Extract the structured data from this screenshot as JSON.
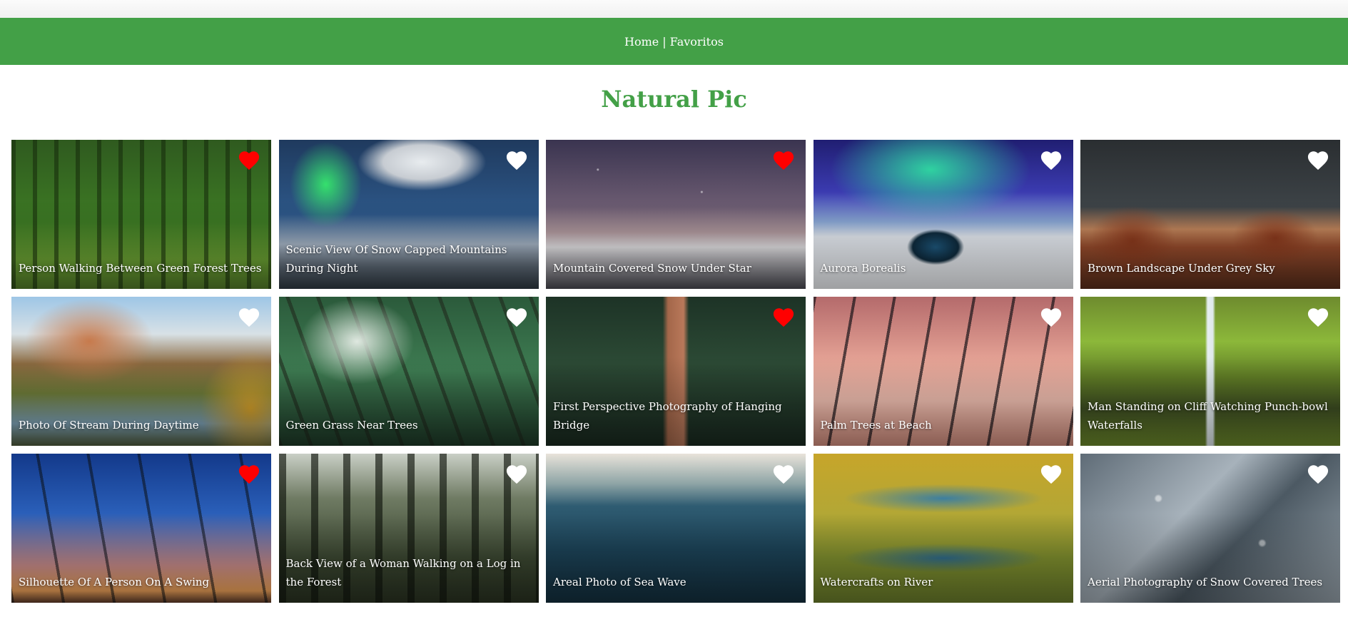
{
  "nav": {
    "home_label": "Home",
    "separator": "|",
    "favorites_label": "Favoritos"
  },
  "title": "Natural Pic",
  "colors": {
    "brand_green": "#43a047",
    "favorite_active": "#ff0000",
    "favorite_inactive": "#ffffff"
  },
  "gallery": [
    {
      "caption": "Person Walking Between Green Forest Trees",
      "favorite": true
    },
    {
      "caption": "Scenic View Of Snow Capped Mountains During Night",
      "favorite": false
    },
    {
      "caption": "Mountain Covered Snow Under Star",
      "favorite": true
    },
    {
      "caption": "Aurora Borealis",
      "favorite": false
    },
    {
      "caption": "Brown Landscape Under Grey Sky",
      "favorite": false
    },
    {
      "caption": "Photo Of Stream During Daytime",
      "favorite": false
    },
    {
      "caption": "Green Grass Near Trees",
      "favorite": false
    },
    {
      "caption": "First Perspective Photography of Hanging Bridge",
      "favorite": true
    },
    {
      "caption": "Palm Trees at Beach",
      "favorite": false
    },
    {
      "caption": "Man Standing on Cliff Watching Punch-bowl Waterfalls",
      "favorite": false
    },
    {
      "caption": "Silhouette Of A Person On A Swing",
      "favorite": true
    },
    {
      "caption": "Back View of a Woman Walking on a Log in the Forest",
      "favorite": false
    },
    {
      "caption": "Areal Photo of Sea Wave",
      "favorite": false
    },
    {
      "caption": "Watercrafts on River",
      "favorite": false
    },
    {
      "caption": "Aerial Photography of Snow Covered Trees",
      "favorite": false
    }
  ]
}
